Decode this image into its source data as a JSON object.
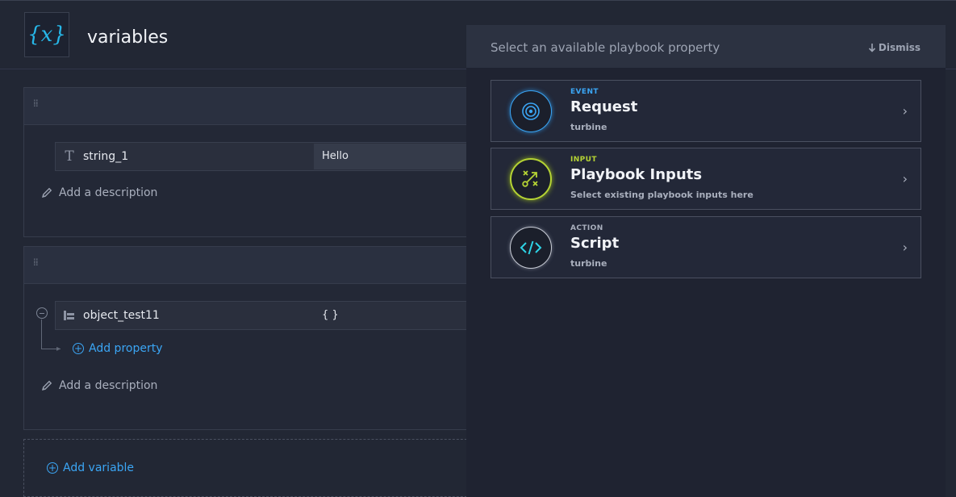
{
  "header": {
    "logo_text": "{x}",
    "title": "variables"
  },
  "variables": [
    {
      "name": "string_1",
      "type_icon": "text-type-icon",
      "value": "Hello",
      "description_placeholder": "Add a description"
    },
    {
      "name": "object_test11",
      "type_icon": "object-type-icon",
      "value": "{ }",
      "add_property_label": "Add property",
      "description_placeholder": "Add a description"
    }
  ],
  "add_variable_label": "Add variable",
  "panel": {
    "title": "Select an available playbook property",
    "dismiss_label": "Dismiss",
    "options": [
      {
        "kind": "EVENT",
        "kind_color": "#3ba6f5",
        "title": "Request",
        "subtitle": "turbine",
        "icon": "request-target-icon"
      },
      {
        "kind": "INPUT",
        "kind_color": "#b5d334",
        "title": "Playbook Inputs",
        "subtitle": "Select existing playbook inputs here",
        "icon": "playbook-inputs-icon"
      },
      {
        "kind": "ACTION",
        "kind_color": "#a9afbd",
        "title": "Script",
        "subtitle": "turbine",
        "icon": "script-code-icon"
      }
    ]
  },
  "colors": {
    "accent_blue": "#3ba6f5",
    "input_green": "#b5d334",
    "script_cyan": "#2ed3e6",
    "background": "#222734"
  }
}
